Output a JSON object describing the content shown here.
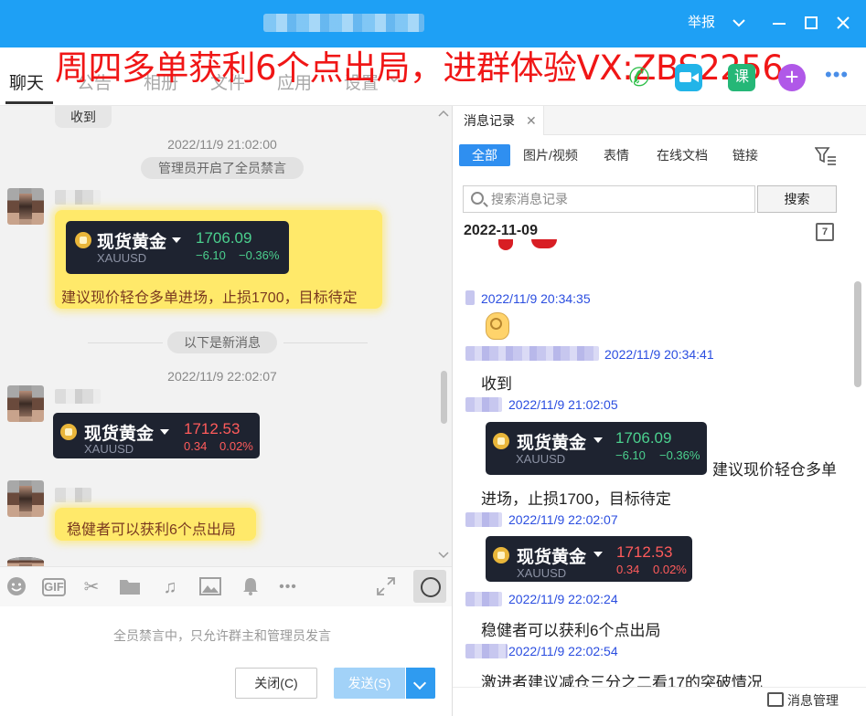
{
  "window": {
    "report_label": "举报"
  },
  "overlay_banner": "周四多单获利6个点出局，进群体验VX:ZBS2256",
  "tabs": [
    {
      "label": "聊天"
    },
    {
      "label": "公告"
    },
    {
      "label": "相册"
    },
    {
      "label": "文件"
    },
    {
      "label": "应用"
    },
    {
      "label": "设置"
    }
  ],
  "toolbar_icons": {
    "class_label": "课",
    "plus_label": "+",
    "more_label": "•••"
  },
  "chat": {
    "prev_bubble_text": "收到",
    "time1": "2022/11/9 21:02:00",
    "system_mute": "管理员开启了全员禁言",
    "card1": {
      "name": "现货黄金",
      "code": "XAUUSD",
      "price": "1706.09",
      "change": "−6.10",
      "change_pct": "−0.36%"
    },
    "msg1": "建议现价轻仓多单进场，止损1700，目标待定",
    "new_messages": "以下是新消息",
    "time2": "2022/11/9 22:02:07",
    "card2": {
      "name": "现货黄金",
      "code": "XAUUSD",
      "price": "1712.53",
      "change": "0.34",
      "change_pct": "0.02%"
    },
    "msg2": "稳健者可以获利6个点出局",
    "mute_notice": "全员禁言中，只允许群主和管理员发言",
    "close_button": "关闭(C)",
    "send_button": "发送(S)"
  },
  "history": {
    "tab_title": "消息记录",
    "filters": [
      "全部",
      "图片/视频",
      "表情",
      "在线文档",
      "链接"
    ],
    "search_placeholder": "搜索消息记录",
    "search_button": "搜索",
    "date": "2022-11-09",
    "calendar_day": "7",
    "entries": [
      {
        "ts": "2022/11/9 20:34:35"
      },
      {
        "ts": "2022/11/9 20:34:41",
        "text": "收到"
      },
      {
        "ts": "2022/11/9 21:02:05",
        "text_a": "建议现价轻仓多单",
        "text_b": "进场，止损1700，目标待定"
      },
      {
        "ts": "2022/11/9 22:02:07"
      },
      {
        "ts": "2022/11/9 22:02:24",
        "text": "稳健者可以获利6个点出局"
      },
      {
        "ts": "2022/11/9 22:02:54",
        "text": "激进者建议减仓三分之二看17的突破情况"
      }
    ],
    "card1": {
      "name": "现货黄金",
      "code": "XAUUSD",
      "price": "1706.09",
      "change": "−6.10",
      "change_pct": "−0.36%"
    },
    "card2": {
      "name": "现货黄金",
      "code": "XAUUSD",
      "price": "1712.53",
      "change": "0.34",
      "change_pct": "0.02%"
    },
    "message_manager": "消息管理"
  }
}
